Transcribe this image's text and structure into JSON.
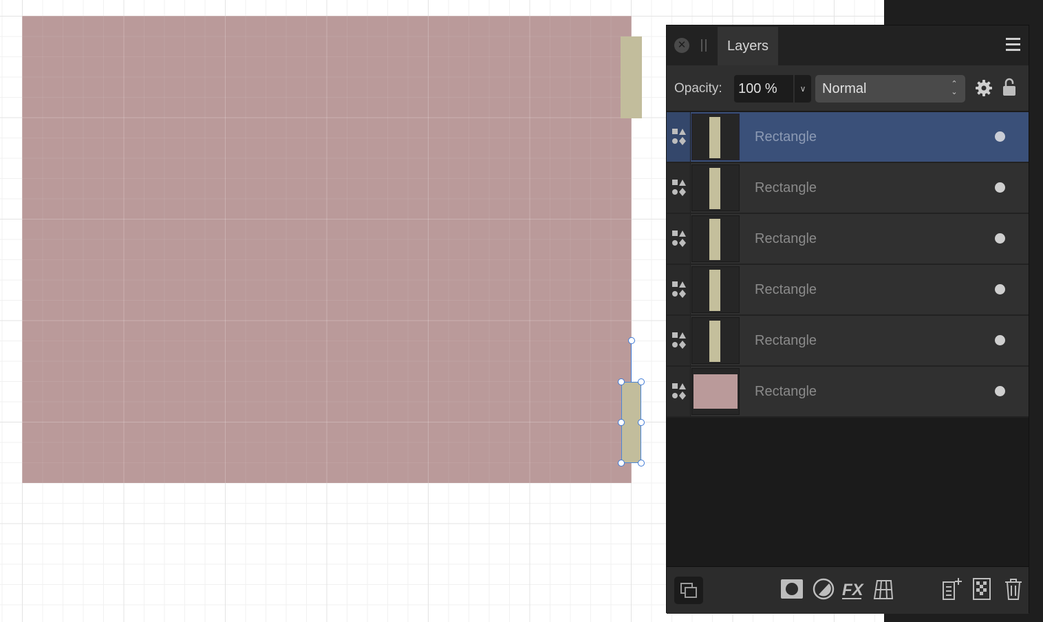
{
  "panel": {
    "tab_label": "Layers",
    "opacity_label": "Opacity:",
    "opacity_value": "100 %",
    "blend_mode": "Normal"
  },
  "layers": [
    {
      "name": "Rectangle",
      "thumb": "strip",
      "selected": true,
      "visible": true
    },
    {
      "name": "Rectangle",
      "thumb": "strip",
      "selected": false,
      "visible": true
    },
    {
      "name": "Rectangle",
      "thumb": "strip",
      "selected": false,
      "visible": true
    },
    {
      "name": "Rectangle",
      "thumb": "strip",
      "selected": false,
      "visible": true
    },
    {
      "name": "Rectangle",
      "thumb": "strip",
      "selected": false,
      "visible": true
    },
    {
      "name": "Rectangle",
      "thumb": "rect",
      "selected": false,
      "visible": true
    }
  ],
  "colors": {
    "big_rectangle": "#ba9a9a",
    "strip": "#c2bd9c",
    "selection": "#3f7ad6",
    "selected_row": "#3a5079"
  },
  "icons": {
    "footer": [
      "mask-icon",
      "adjustment-icon",
      "fx-icon",
      "mesh-warp-icon",
      "add-pixel-layer-icon",
      "add-transparency-layer-icon",
      "trash-icon"
    ]
  }
}
